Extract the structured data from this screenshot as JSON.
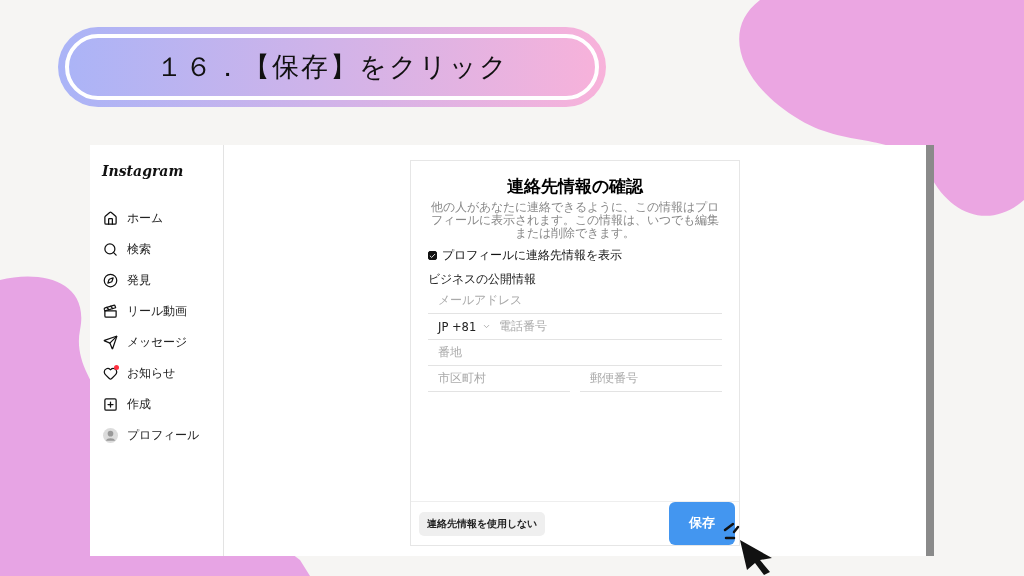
{
  "slide_title": "１６．【保存】をクリック",
  "sidebar": {
    "logo": "Instagram",
    "items": [
      {
        "label": "ホーム",
        "badge": false
      },
      {
        "label": "検索",
        "badge": false
      },
      {
        "label": "発見",
        "badge": false
      },
      {
        "label": "リール動画",
        "badge": false
      },
      {
        "label": "メッセージ",
        "badge": false
      },
      {
        "label": "お知らせ",
        "badge": true
      },
      {
        "label": "作成",
        "badge": false
      },
      {
        "label": "プロフィール",
        "badge": false
      }
    ]
  },
  "dialog": {
    "title": "連絡先情報の確認",
    "description": "他の人があなたに連絡できるように、この情報はプロフィールに表示されます。この情報は、いつでも編集または削除できます。",
    "show_contact": {
      "label": "プロフィールに連絡先情報を表示",
      "checked": true
    },
    "section_title": "ビジネスの公開情報",
    "rows": [
      {
        "kind": "text",
        "placeholder": "メールアドレス"
      },
      {
        "kind": "phone",
        "country": "JP +81",
        "placeholder": "電話番号"
      },
      {
        "kind": "text",
        "placeholder": "番地"
      },
      {
        "kind": "pair",
        "placeholders": [
          "市区町村",
          "郵便番号"
        ]
      }
    ],
    "secondary_button": "連絡先情報を使用しない",
    "save_button": "保存"
  }
}
